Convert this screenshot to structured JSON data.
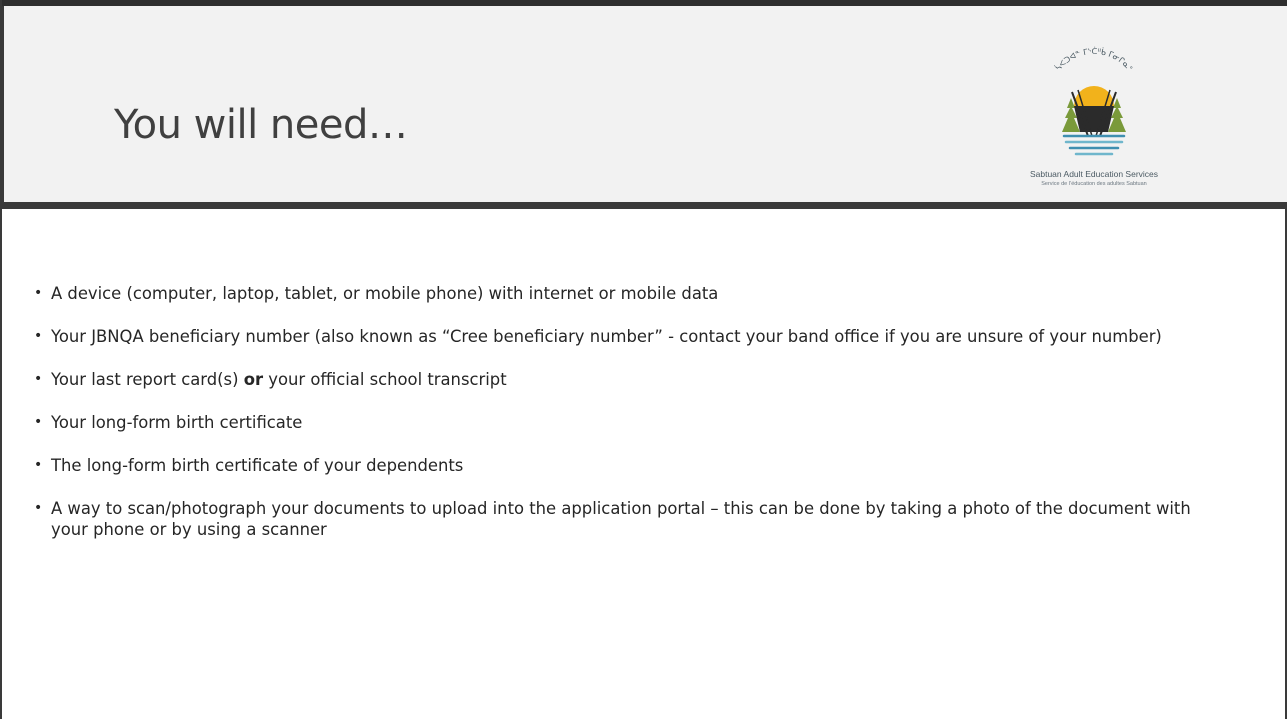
{
  "slide": {
    "title": "You will need…",
    "logo": {
      "syllabics": "ᓵᐸᑐᐊᓐ ᒥᔅᑖᐦᑳ ᒥᓂᒋᓇᐤ",
      "name": "Sabtuan Adult Education Services",
      "subtitle": "Service de l’éducation des adultes Sabtuan",
      "colors": {
        "sun": "#f2b21b",
        "tent": "#2b2b2b",
        "trees": "#7a9a3a",
        "water": "#3f8fb0",
        "text": "#4b5a63"
      }
    },
    "bullets": [
      {
        "text": " A device (computer, laptop, tablet, or mobile phone) with internet or mobile data"
      },
      {
        "text": "Your JBNQA beneficiary number (also known as “Cree beneficiary number” - contact your band office if you are unsure of your number)"
      },
      {
        "before": "Your last report card(s) ",
        "bold": "or",
        "after": " your official school transcript"
      },
      {
        "text": "Your long-form birth certificate"
      },
      {
        "text": "The long-form birth certificate of your dependents"
      },
      {
        "text": "A way to scan/photograph your documents to upload into the application portal – this can be done by taking a photo of the document with your phone or by using a scanner"
      }
    ]
  }
}
